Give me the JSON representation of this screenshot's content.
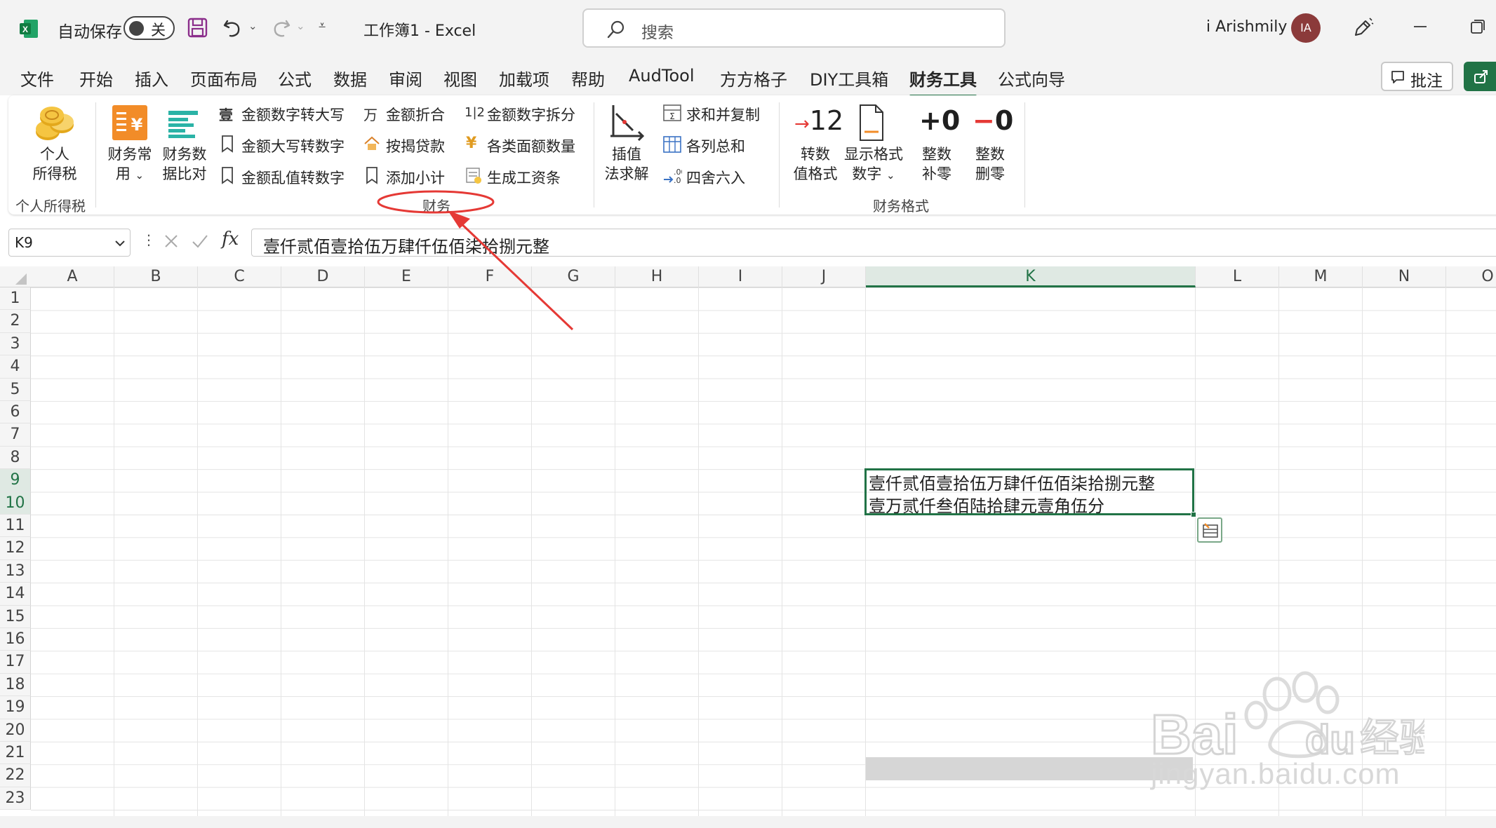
{
  "titlebar": {
    "autosave_label": "自动保存",
    "autosave_state": "关",
    "doc_title": "工作簿1  -  Excel",
    "search_placeholder": "搜索",
    "user_name": "i Arishmily",
    "avatar_initials": "IA"
  },
  "menu": {
    "tabs": [
      "文件",
      "开始",
      "插入",
      "页面布局",
      "公式",
      "数据",
      "审阅",
      "视图",
      "加载项",
      "帮助",
      "AudTool",
      "方方格子",
      "DIY工具箱",
      "财务工具",
      "公式向导"
    ],
    "active_tab": "财务工具",
    "comment_label": "批注"
  },
  "ribbon": {
    "group_tax": {
      "label": "个人所得税",
      "button_line1": "个人",
      "button_line2": "所得税"
    },
    "group_finance": {
      "label": "财务",
      "big1_line1": "财务常",
      "big1_line2": "用",
      "big2_line1": "财务数",
      "big2_line2": "据比对",
      "col1": [
        "金额数字转大写",
        "金额大写转数字",
        "金额乱值转数字"
      ],
      "col2": [
        "金额折合",
        "按揭贷款",
        "添加小计"
      ],
      "col3": [
        "金额数字拆分",
        "各类面额数量",
        "生成工资条"
      ],
      "big3_line1": "插值",
      "big3_line2": "法求解",
      "col4": [
        "求和并复制",
        "各列总和",
        "四舍六入"
      ]
    },
    "group_format": {
      "label": "财务格式",
      "btn1_icon": "→12",
      "btn1_line1": "转数",
      "btn1_line2": "值格式",
      "btn2_line1": "显示格式",
      "btn2_line2": "数字",
      "btn3_icon": "+0",
      "btn3_line1": "整数",
      "btn3_line2": "补零",
      "btn4_icon": "−0",
      "btn4_line1": "整数",
      "btn4_line2": "删零"
    }
  },
  "formula_bar": {
    "name_box": "K9",
    "fx": "fx",
    "value": "壹仟贰佰壹拾伍万肆仟伍佰柒拾捌元整"
  },
  "grid": {
    "columns": [
      "A",
      "B",
      "C",
      "D",
      "E",
      "F",
      "G",
      "H",
      "I",
      "J",
      "K",
      "L",
      "M",
      "N",
      "O"
    ],
    "selected_column": "K",
    "rows": [
      "1",
      "2",
      "3",
      "4",
      "5",
      "6",
      "7",
      "8",
      "9",
      "10",
      "11",
      "12",
      "13",
      "14",
      "15",
      "16",
      "17",
      "18",
      "19",
      "20",
      "21",
      "22",
      "23"
    ],
    "selected_rows": [
      "9",
      "10"
    ],
    "cells": {
      "K9": "壹仟贰佰壹拾伍万肆仟伍佰柒拾捌元整",
      "K10": "壹万贰仟叁佰陆拾肆元壹角伍分"
    }
  },
  "watermark": {
    "text": "jingyan.baidu.com"
  },
  "colors": {
    "excel_green": "#217346",
    "annotation_red": "#e53935",
    "selection_fill": "#d6d6d6"
  }
}
